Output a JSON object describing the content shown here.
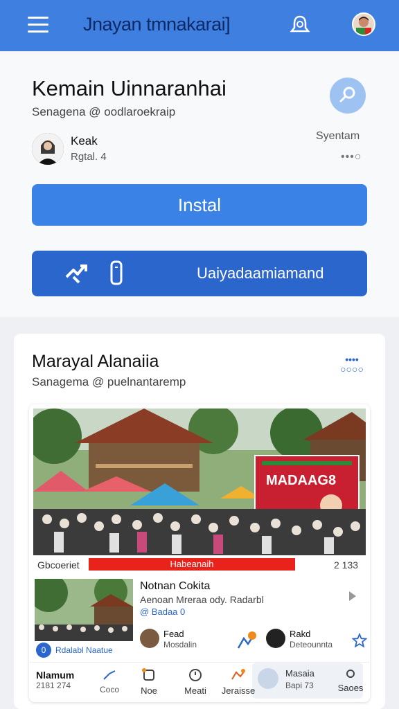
{
  "topbar": {
    "title": "Jnayan tmnakarai]"
  },
  "app": {
    "name": "Kemain Uinnaranhai",
    "subtitle": "Senagena @ oodlaroekraip",
    "developer_name": "Keak",
    "developer_meta": "Rgtal. 4",
    "system_label": "Syentam",
    "system_dots": "•••○",
    "install_label": "Instal",
    "secondary_label": "Uaiyadaamiamand"
  },
  "feed": {
    "title": "Marayal  Alanaiia",
    "subtitle": "Sanagema @ puelnantaremp",
    "more": "••••\n○○○○",
    "photo": {
      "banner_text": "MADAAG8",
      "caption_left": "Gbcoeriet",
      "caption_red": "Habeanaih",
      "caption_right": "2  133"
    },
    "sub_item": {
      "title": "Notnan Cokita",
      "line": "Aenoan Mreraa ody. Radarbl",
      "link": "@ Badaa 0",
      "badge_icon": "0",
      "badge_text": "Rdalabl  Naatue"
    },
    "people": [
      {
        "name": "Fead",
        "meta": "Mosdalin"
      },
      {
        "name": "Rakd",
        "meta": "Deteounnta"
      }
    ],
    "tabs": [
      {
        "label": "Nlamum",
        "sub": "2181  274",
        "sub2": "Coco"
      },
      {
        "label": "Noe"
      },
      {
        "label": "Meati"
      },
      {
        "label": "Jeraisse"
      },
      {
        "label": "Masaia",
        "sub": "Bapi  73"
      },
      {
        "label": "Saoes"
      }
    ]
  },
  "colors": {
    "topbar": "#3f7fe0",
    "primary_button": "#3b82e6",
    "secondary_button": "#2a66cc",
    "red_banner": "#e8231c"
  }
}
